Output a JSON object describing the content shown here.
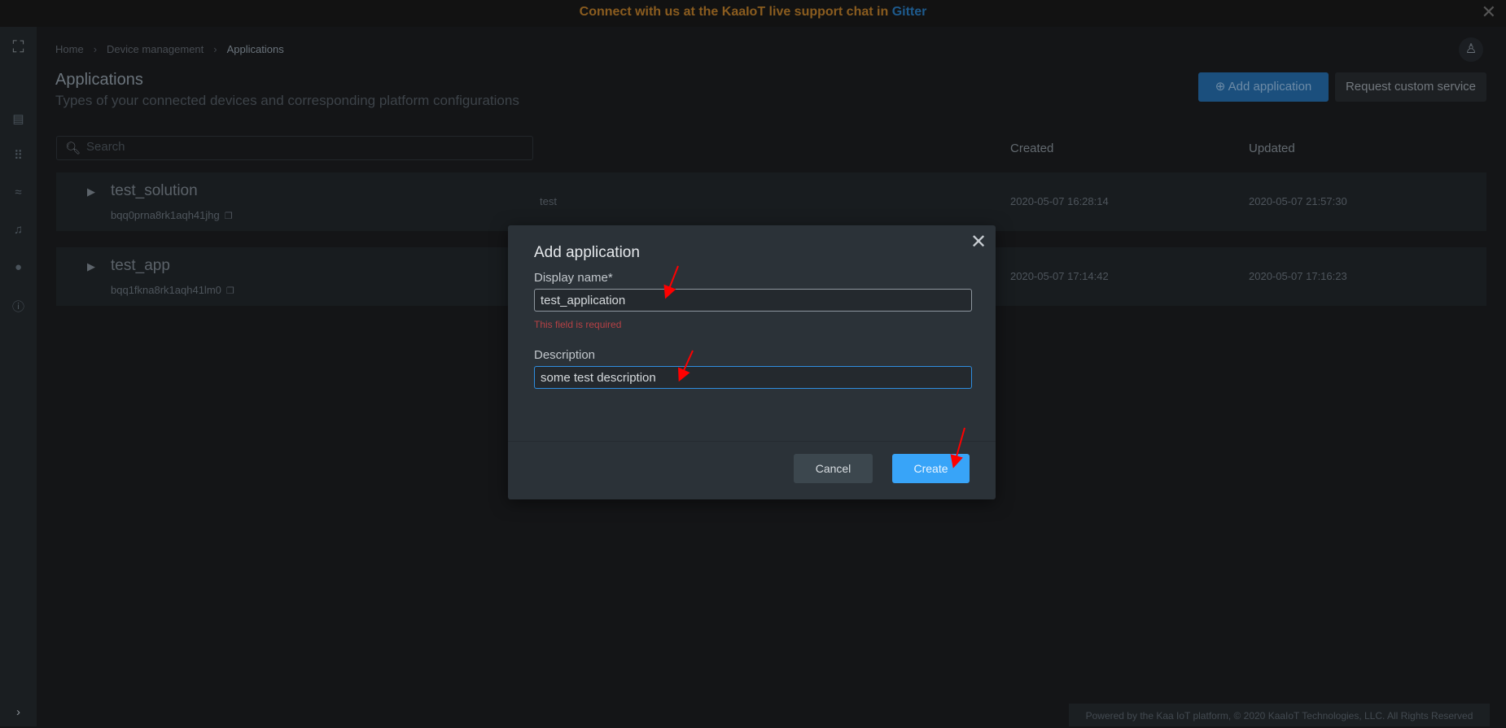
{
  "banner": {
    "text": "Connect with us at the KaaIoT live support chat in ",
    "link": "Gitter",
    "close_icon": "close-icon",
    "text_color": "#f0a030",
    "link_color": "#2e8bd8"
  },
  "sidebar": {
    "items": [
      {
        "icon": "dashboard-icon"
      },
      {
        "icon": "apps-grid-icon"
      },
      {
        "icon": "analytics-icon"
      },
      {
        "icon": "bell-icon"
      },
      {
        "icon": "account-icon"
      },
      {
        "icon": "help-icon"
      }
    ],
    "expand_icon": "chevron-right-icon"
  },
  "breadcrumb": [
    "Home",
    "Device management",
    "Applications"
  ],
  "header": {
    "title": "Applications",
    "subtitle": "Types of your connected devices and corresponding platform configurations",
    "add_label": "Add application",
    "request_label": "Request custom service"
  },
  "search": {
    "placeholder": "Search",
    "value": ""
  },
  "table": {
    "columns": [
      "Created",
      "Updated"
    ],
    "rows": [
      {
        "name": "test_solution",
        "id": "bqq0prna8rk1aqh41jhg",
        "description": "test",
        "created": "2020-05-07 16:28:14",
        "updated": "2020-05-07 21:57:30"
      },
      {
        "name": "test_app",
        "id": "bqq1fkna8rk1aqh41lm0",
        "description": "",
        "created": "2020-05-07 17:14:42",
        "updated": "2020-05-07 17:16:23"
      }
    ]
  },
  "footer": "Powered by the Kaa IoT platform, © 2020 KaaIoT Technologies, LLC. All Rights Reserved",
  "modal": {
    "title": "Add application",
    "name_label": "Display name*",
    "name_value": "test_application",
    "name_error": "This field is required",
    "desc_label": "Description",
    "desc_value": "some test description",
    "cancel": "Cancel",
    "create": "Create",
    "accent": "#38a4f8"
  }
}
